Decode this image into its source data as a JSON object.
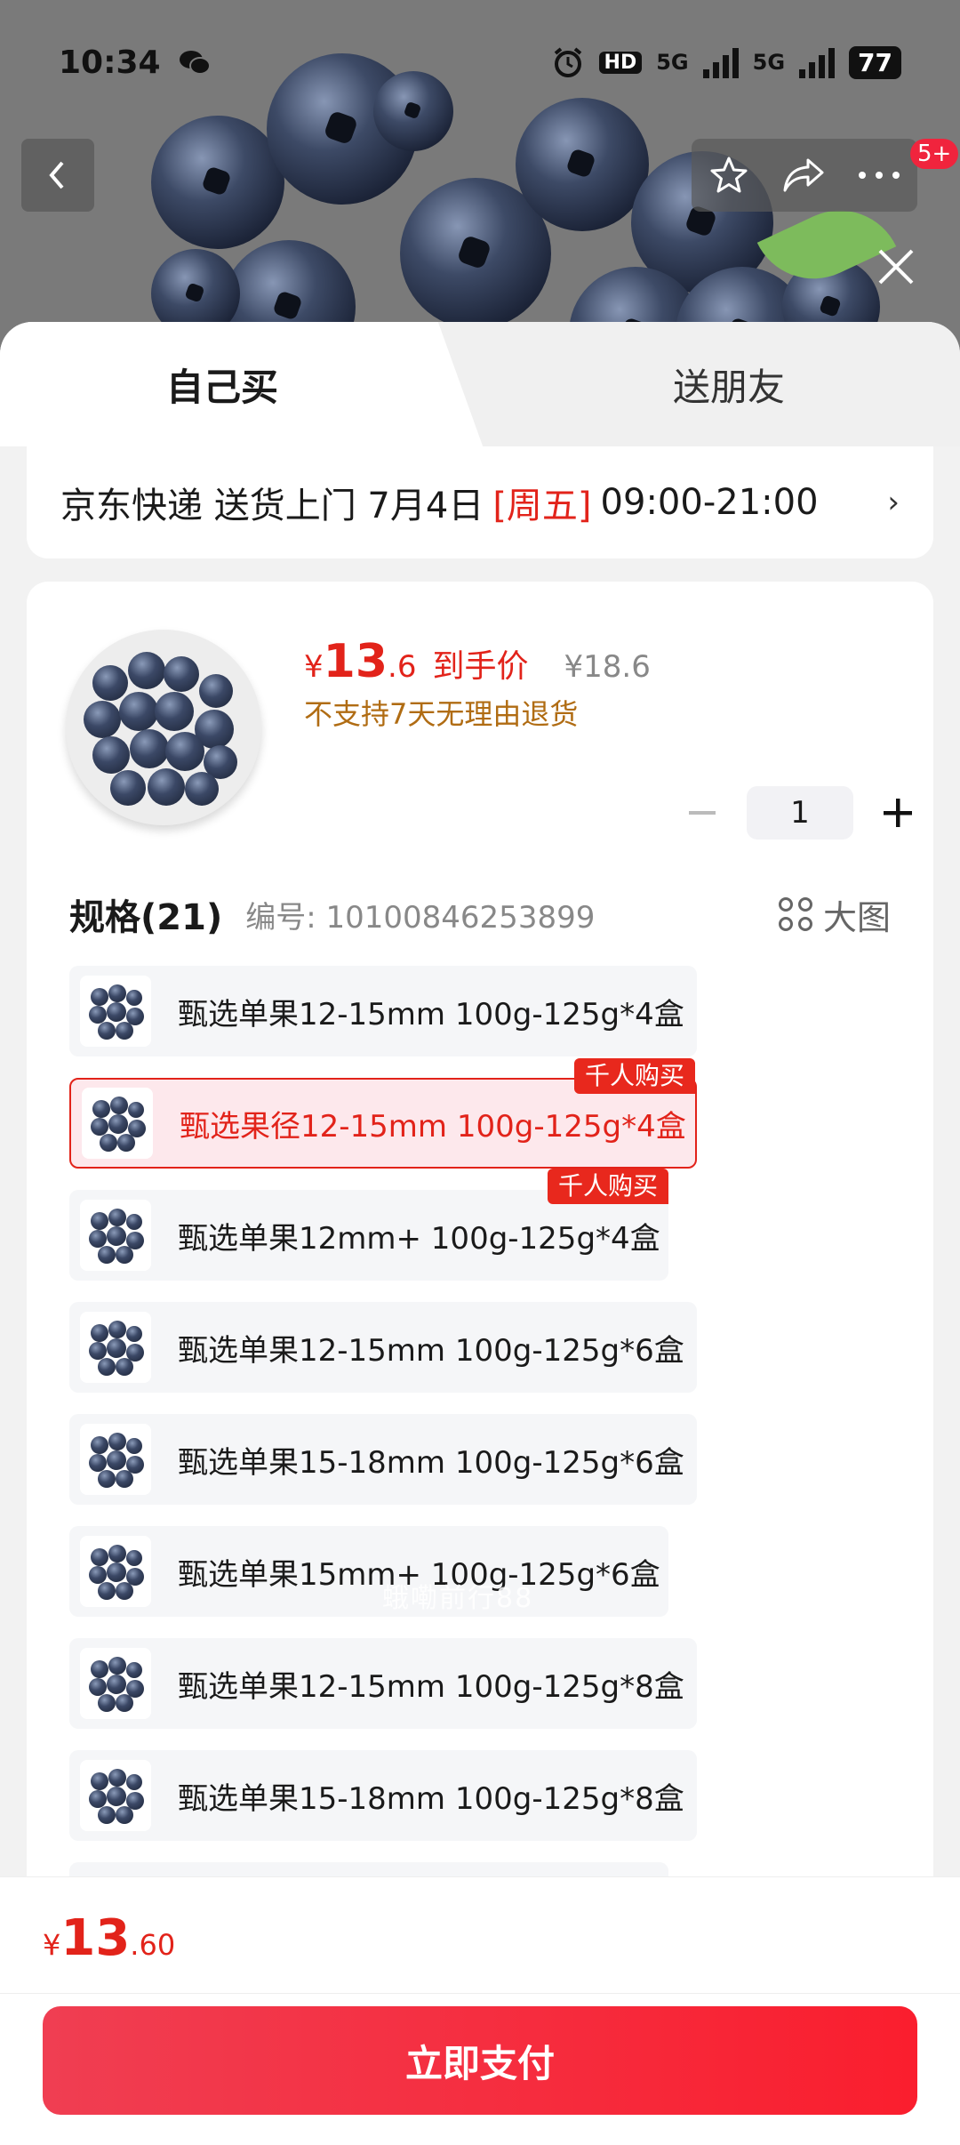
{
  "status_bar": {
    "time": "10:34",
    "battery": "77",
    "network_1": "5G",
    "network_2": "5G"
  },
  "nav": {
    "notification_badge": "5+"
  },
  "tabs": [
    {
      "label": "自己买",
      "active": true
    },
    {
      "label": "送朋友",
      "active": false
    }
  ],
  "delivery": {
    "carrier": "京东快递 送货上门 7月4日",
    "weekday": "[周五]",
    "time_window": "09:00-21:00"
  },
  "product": {
    "price_symbol": "¥",
    "price_int": "13",
    "price_dec": ".6",
    "price_label": "到手价",
    "original_price": "¥18.6",
    "return_policy": "不支持7天无理由退货",
    "quantity": "1"
  },
  "spec": {
    "title": "规格(21)",
    "code": "编号: 10100846253899",
    "big_image_label": "大图",
    "items": [
      {
        "label": "甄选单果12-15mm 100g-125g*4盒",
        "selected": false,
        "tag": ""
      },
      {
        "label": "甄选果径12-15mm 100g-125g*4盒",
        "selected": true,
        "tag": "千人购买"
      },
      {
        "label": "甄选单果12mm+ 100g-125g*4盒",
        "selected": false,
        "tag": "千人购买"
      },
      {
        "label": "甄选单果12-15mm 100g-125g*6盒",
        "selected": false,
        "tag": ""
      },
      {
        "label": "甄选单果15-18mm 100g-125g*6盒",
        "selected": false,
        "tag": ""
      },
      {
        "label": "甄选单果15mm+ 100g-125g*6盒",
        "selected": false,
        "tag": ""
      },
      {
        "label": "甄选单果12-15mm 100g-125g*8盒",
        "selected": false,
        "tag": ""
      },
      {
        "label": "甄选单果15-18mm 100g-125g*8盒",
        "selected": false,
        "tag": ""
      }
    ]
  },
  "watermark": "蛾嘞前行88",
  "footer": {
    "price_symbol": "¥",
    "price_int": "13",
    "price_dec": ".60",
    "pay_label": "立即支付"
  },
  "colors": {
    "accent": "#e2231a",
    "pay_button": "#f52a3b",
    "return_text": "#b06c13"
  },
  "icons": [
    "back-icon",
    "star-icon",
    "share-icon",
    "more-icon",
    "close-icon",
    "minus-icon",
    "plus-icon",
    "grid-icon",
    "chevron-right-icon"
  ]
}
